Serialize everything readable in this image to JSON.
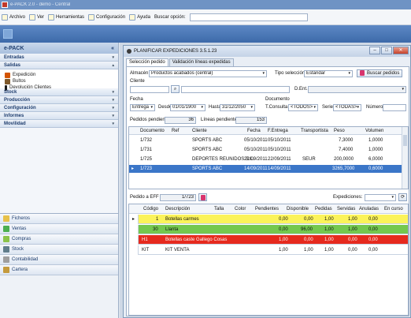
{
  "app": {
    "title": "e-PACK 2.0 - demo - Central"
  },
  "menu": {
    "items": [
      "Archivo",
      "Ver",
      "Herramientas",
      "Configuración",
      "Ayuda"
    ],
    "search_label": "Buscar opción:",
    "search_value": ""
  },
  "sidebar": {
    "title": "e-PACK",
    "sections_top": [
      "Entradas",
      "Salidas"
    ],
    "salidas_items": [
      "Expedición",
      "Bultos",
      "Devolución Clientes"
    ],
    "sections_mid": [
      "Stock",
      "Producción",
      "Configuración",
      "Informes",
      "Movilidad"
    ],
    "modules": [
      "Ficheros",
      "Ventas",
      "Compras",
      "Stock",
      "Contabilidad",
      "Cartera"
    ]
  },
  "window": {
    "title": "PLANIFICAR EXPEDICIONES 3.5.1.23",
    "tabs": [
      "Selección pedido",
      "Validación líneas expedidas"
    ]
  },
  "form": {
    "almacen_label": "Almacén",
    "almacen_value": "Productos acabados (central)",
    "tipo_sel_label": "Tipo selección",
    "tipo_sel_value": "Estándar",
    "buscar_pedidos": "Buscar pedidos",
    "cliente_label": "Cliente",
    "cliente_code": "",
    "cliente_name": "",
    "dent_label": "D.Ent.",
    "dent_value": "",
    "fecha_label": "Fecha",
    "fecha_value": "Entrega",
    "desde_label": "Desde",
    "desde_value": "01/01/1900",
    "hasta_label": "Hasta",
    "hasta_value": "31/12/2050",
    "documento_label": "Documento",
    "tconsulta_label": "T.Consulta",
    "tconsulta_value": "<TODOS>",
    "serie_label": "Serie",
    "serie_value": "<TODAS>",
    "numero_label": "Número",
    "numero_value": "",
    "pedidos_pend_label": "Pedidos pendientes",
    "pedidos_pend_value": "36",
    "lineas_pend_label": "Líneas pendientes",
    "lineas_pend_value": "153",
    "pedido_label": "Pedido a EFF",
    "pedido_value": "1/723",
    "expediciones_label": "Expediciones:",
    "expediciones_value": ""
  },
  "orders_table": {
    "headers": [
      "Documento",
      "Ref",
      "Cliente",
      "Fecha",
      "F.Entrega",
      "Transportista",
      "Peso",
      "Volumen"
    ],
    "rows": [
      [
        "1/732",
        "",
        "SPORTS ABC",
        "05/10/2011",
        "05/10/2011",
        "",
        "7,3000",
        "1,0000"
      ],
      [
        "1/731",
        "",
        "SPORTS ABC",
        "05/10/2011",
        "05/10/2011",
        "",
        "7,4000",
        "1,0000"
      ],
      [
        "1/725",
        "",
        "DEPORTES REUNIDOS S.L.",
        "22/09/2011",
        "22/09/2011",
        "SEUR",
        "200,0000",
        "6,0000"
      ],
      [
        "1/723",
        "",
        "SPORTS ABC",
        "14/09/2011",
        "14/09/2011",
        "",
        "3265,7000",
        "0,6000"
      ]
    ]
  },
  "lines_table": {
    "headers": [
      "Código",
      "Descripción",
      "Talla",
      "Color",
      "Pendientes",
      "Disponible",
      "Pedidas",
      "Servidas",
      "Anuladas",
      "En curso"
    ],
    "rows": [
      [
        "1",
        "Botellas carmes",
        "",
        "",
        "0,00",
        "0,00",
        "1,00",
        "1,00",
        "0,00"
      ],
      [
        "30",
        "Llanta",
        "",
        "",
        "0,00",
        "96,00",
        "1,00",
        "1,00",
        "0,00"
      ],
      [
        "H1",
        "Botellas caste Gallego Cosas",
        "",
        "",
        "1,00",
        "0,00",
        "1,00",
        "0,00",
        "0,00"
      ],
      [
        "KIT",
        "KIT VENTA",
        "",
        "",
        "1,00",
        "1,00",
        "1,00",
        "0,00",
        "0,00"
      ]
    ]
  }
}
